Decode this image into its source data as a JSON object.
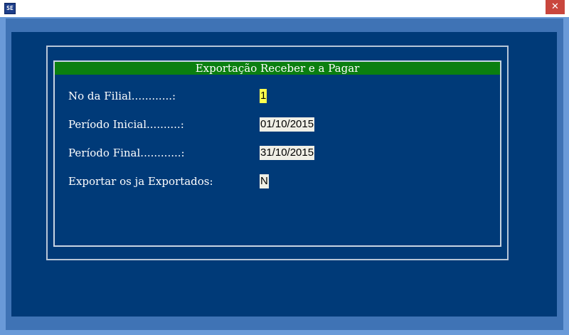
{
  "window": {
    "icon_text": "SE",
    "close_label": "✕"
  },
  "dialog": {
    "title": "Exportação Receber e a Pagar",
    "fields": [
      {
        "label": "No da Filial............:",
        "value": "1"
      },
      {
        "label": "Período Inicial..........:",
        "value": "01/10/2015"
      },
      {
        "label": "Período Final............:",
        "value": "31/10/2015"
      },
      {
        "label": "Exportar os ja Exportados:",
        "value": "N"
      }
    ]
  },
  "colors": {
    "title_bar": "#0b7f10",
    "background": "#003a78",
    "active_field": "#ffff4d",
    "field": "#f0efe6"
  }
}
